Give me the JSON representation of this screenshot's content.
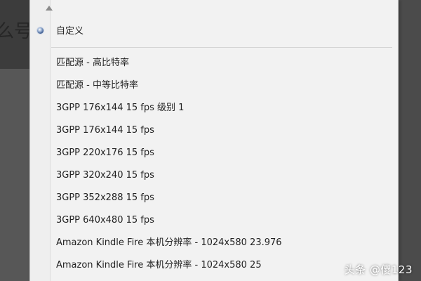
{
  "background_fragment": "么号",
  "menu": {
    "scroll_icon": "triangle-up-icon",
    "selected_item": "自定义",
    "items": [
      "匹配源 - 高比特率",
      "匹配源 - 中等比特率",
      "3GPP 176x144 15 fps 级别 1",
      "3GPP 176x144 15 fps",
      "3GPP 220x176 15 fps",
      "3GPP 320x240 15 fps",
      "3GPP 352x288 15 fps",
      "3GPP 640x480 15 fps",
      "Amazon Kindle Fire 本机分辨率 - 1024x580 23.976",
      "Amazon Kindle Fire 本机分辨率 - 1024x580 25"
    ]
  },
  "watermark": "头条 @傻123",
  "colors": {
    "menu_background": "#f2f2f2",
    "text": "#222222",
    "radio_selected": "#2f4f86",
    "backdrop": "#4d4d4d"
  }
}
